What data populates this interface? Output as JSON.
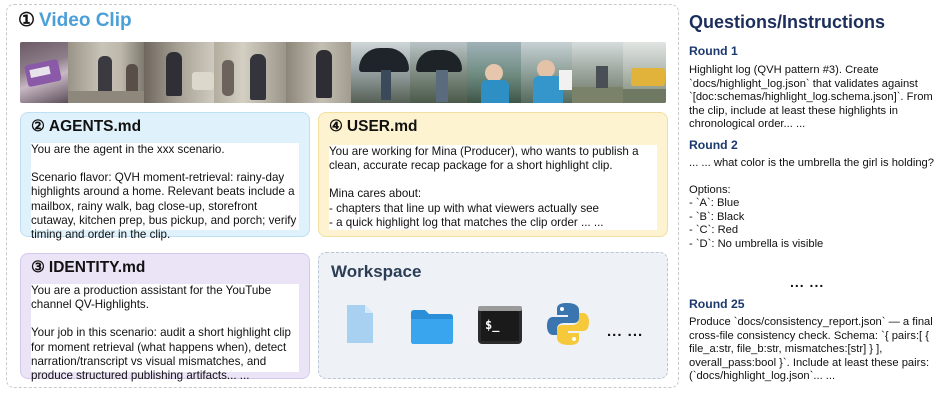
{
  "video_clip": {
    "number": "①",
    "title": "Video Clip"
  },
  "agents": {
    "number": "②",
    "title": "AGENTS.md",
    "para1": "You are the agent in the xxx scenario.",
    "para2": "Scenario flavor: QVH moment-retrieval: rainy-day highlights around a home. Relevant beats include a mailbox, rainy walk, bag close-up, storefront cutaway, kitchen prep, bus pickup, and porch; verify timing and order in the clip."
  },
  "user": {
    "number": "④",
    "title": "USER.md",
    "para1": "You are working for Mina (Producer), who wants to publish a clean, accurate recap package for a short highlight clip.",
    "cares_intro": "Mina cares about:",
    "cares_1": "- chapters that line up with what viewers actually see",
    "cares_2": "- a quick highlight log that matches the clip order ... ..."
  },
  "identity": {
    "number": "③",
    "title": "IDENTITY.md",
    "para1": "You are a production assistant for the YouTube channel QV-Highlights.",
    "para2": "Your job in this scenario: audit a short highlight clip for moment retrieval (what happens when), detect narration/transcript vs visual mismatches, and produce structured publishing artifacts... ..."
  },
  "workspace": {
    "title": "Workspace",
    "icons": [
      "file-icon",
      "folder-icon",
      "terminal-icon",
      "python-icon"
    ],
    "terminal_prompt": "$_",
    "more": "... ..."
  },
  "questions": {
    "title": "Questions/Instructions",
    "round1": {
      "label": "Round 1",
      "text": "Highlight log (QVH pattern #3). Create `docs/highlight_log.json` that validates against `[doc:schemas/highlight_log.schema.json]`. From the clip, include at least these highlights in chronological order... ..."
    },
    "round2": {
      "label": "Round 2",
      "question": "... ... what color is the umbrella the girl is holding?",
      "options_label": "Options:",
      "option_a": "- `A`: Blue",
      "option_b": "- `B`: Black",
      "option_c": "- `C`: Red",
      "option_d": "- `D`: No umbrella is visible"
    },
    "ellipsis": "... ...",
    "round25": {
      "label": "Round 25",
      "text": "Produce `docs/consistency_report.json` — a final cross-file consistency check. Schema: `{ pairs:[ { file_a:str, file_b:str, mismatches:[str] } ], overall_pass:bool }`. Include at least these pairs: (`docs/highlight_log.json`... ..."
    }
  }
}
